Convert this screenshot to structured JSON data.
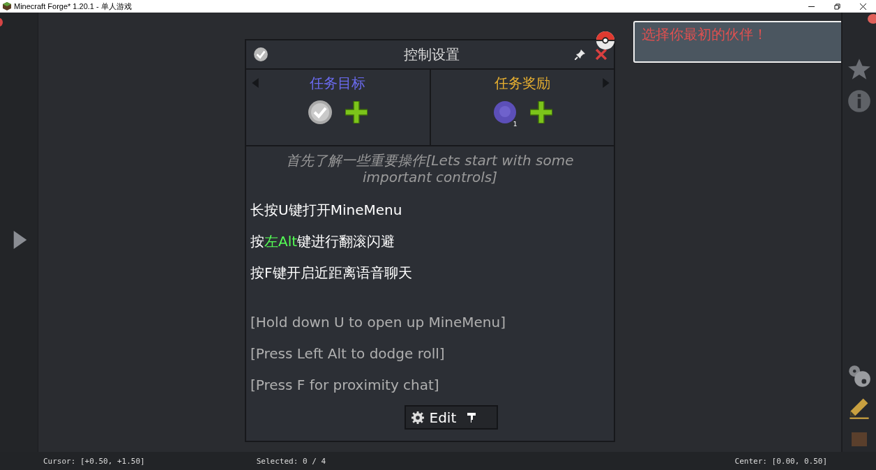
{
  "window": {
    "title": "Minecraft Forge* 1.20.1 - 单人游戏"
  },
  "dialog": {
    "title": "控制设置",
    "sections": [
      {
        "label": "任务目标",
        "kind": "tasks"
      },
      {
        "label": "任务奖励",
        "kind": "rewards",
        "count": "1"
      }
    ],
    "lines": [
      {
        "kind": "intro",
        "segments": [
          {
            "text": "首先了解一些重要操作[Lets start with some important controls]",
            "highlight": false
          }
        ]
      },
      {
        "kind": "cn",
        "segments": [
          {
            "text": "长按U键打开MineMenu",
            "highlight": false
          }
        ]
      },
      {
        "kind": "cn",
        "segments": [
          {
            "text": "按",
            "highlight": false
          },
          {
            "text": "左Alt",
            "highlight": true
          },
          {
            "text": "键进行翻滚闪避",
            "highlight": false
          }
        ]
      },
      {
        "kind": "cn",
        "segments": [
          {
            "text": "按F键开启近距离语音聊天",
            "highlight": false
          }
        ]
      },
      {
        "kind": "en",
        "segments": [
          {
            "text": "[Hold down U to open up MineMenu]",
            "highlight": false
          }
        ]
      },
      {
        "kind": "en",
        "segments": [
          {
            "text": "[Press Left Alt to dodge roll]",
            "highlight": false
          }
        ]
      },
      {
        "kind": "en",
        "segments": [
          {
            "text": "[Press F for proximity chat]",
            "highlight": false
          }
        ]
      }
    ],
    "edit_button": "Edit"
  },
  "toast": {
    "text": "选择你最初的伙伴！"
  },
  "status_bar": {
    "cursor": "Cursor: [+0.50, +1.50]",
    "selected": "Selected: 0 / 4",
    "center": "Center: [0.00, 0.50]"
  }
}
